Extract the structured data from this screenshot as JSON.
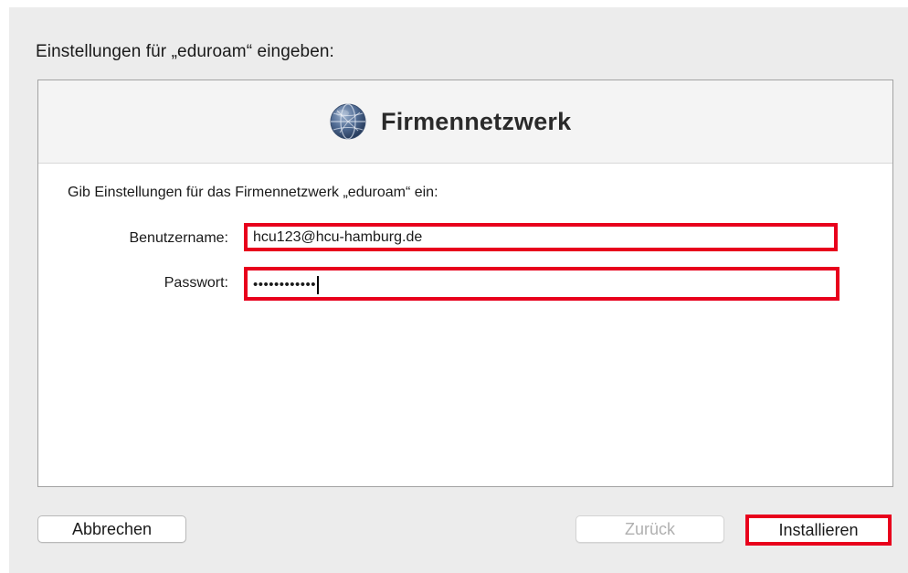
{
  "dialog": {
    "heading": "Einstellungen für „eduroam“ eingeben:"
  },
  "panel": {
    "title": "Firmennetzwerk",
    "icon": "network-globe-icon",
    "prompt": "Gib Einstellungen für das Firmennetzwerk „eduroam“ ein:"
  },
  "form": {
    "username_label": "Benutzername:",
    "username_value": "hcu123@hcu-hamburg.de",
    "password_label": "Passwort:",
    "password_value": "••••••••••••"
  },
  "buttons": {
    "cancel": "Abbrechen",
    "back": "Zurück",
    "install": "Installieren"
  },
  "colors": {
    "highlight": "#e8001c",
    "window_bg": "#ececec",
    "disabled_text": "#b0b0b0"
  }
}
